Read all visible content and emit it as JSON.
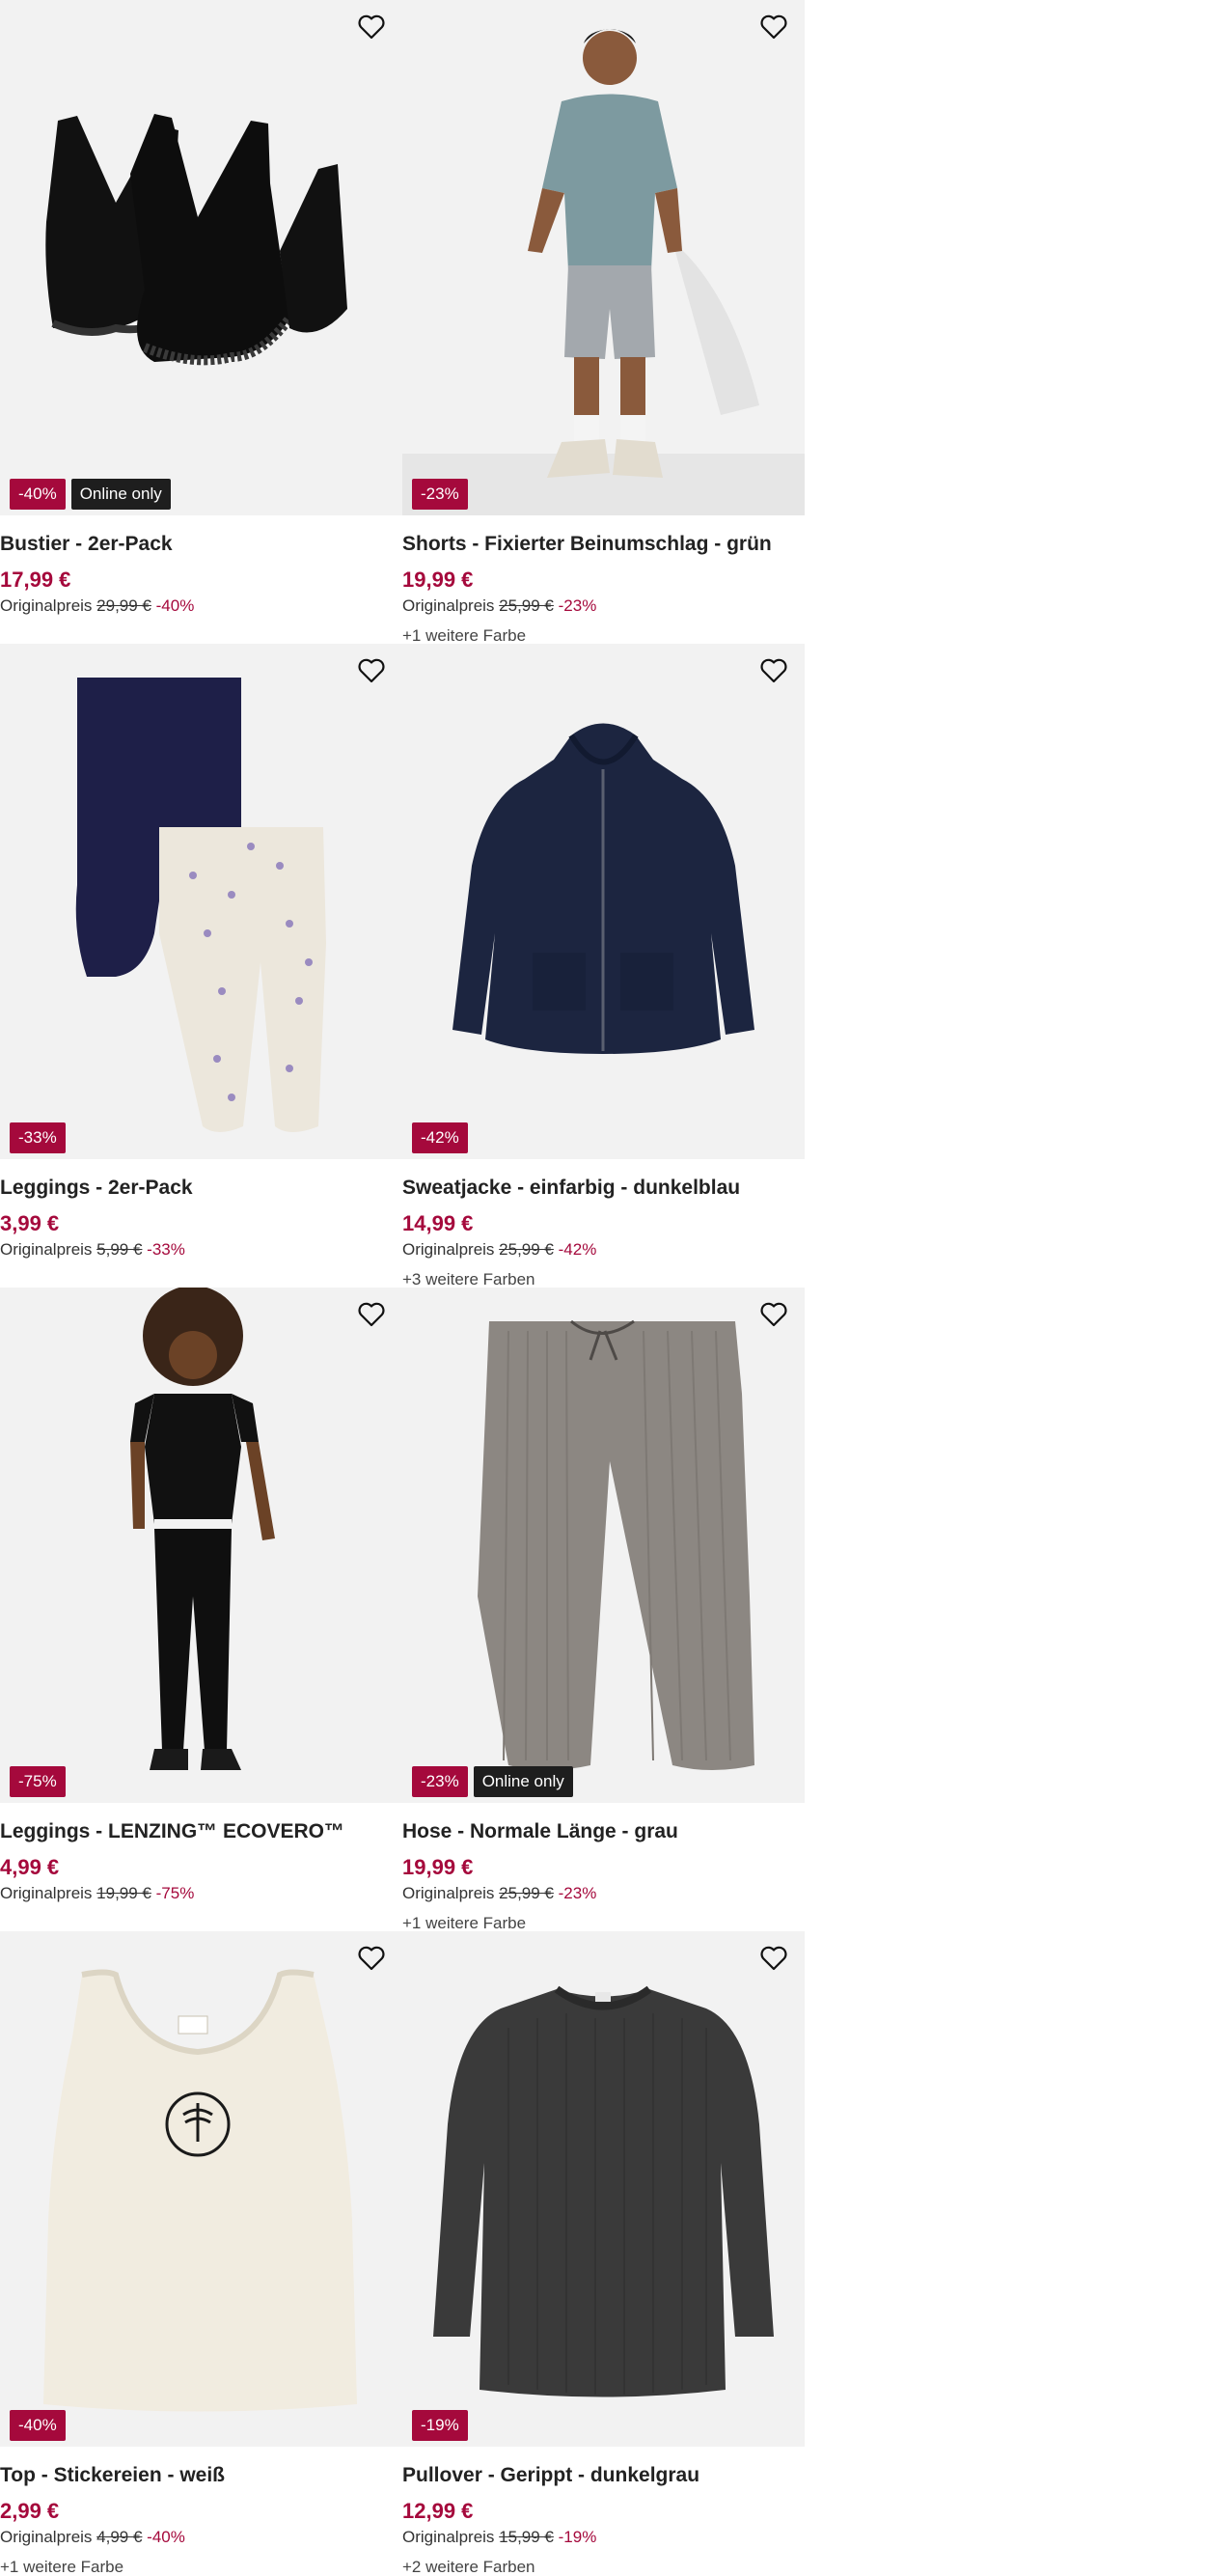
{
  "products": [
    {
      "title": "Bustier - 2er-Pack",
      "price": "17,99 €",
      "orig_label": "Originalpreis",
      "orig_price": "29,99 €",
      "discount": "-40%",
      "badge": "-40%",
      "online": "Online only",
      "more": ""
    },
    {
      "title": "Shorts - Fixierter Beinumschlag - grün",
      "price": "19,99 €",
      "orig_label": "Originalpreis",
      "orig_price": "25,99 €",
      "discount": "-23%",
      "badge": "-23%",
      "online": "",
      "more": "+1 weitere Farbe"
    },
    {
      "title": "Leggings - 2er-Pack",
      "price": "3,99 €",
      "orig_label": "Originalpreis",
      "orig_price": "5,99 €",
      "discount": "-33%",
      "badge": "-33%",
      "online": "",
      "more": ""
    },
    {
      "title": "Sweatjacke - einfarbig - dunkelblau",
      "price": "14,99 €",
      "orig_label": "Originalpreis",
      "orig_price": "25,99 €",
      "discount": "-42%",
      "badge": "-42%",
      "online": "",
      "more": "+3 weitere Farben"
    },
    {
      "title": "Leggings - LENZING™ ECOVERO™",
      "price": "4,99 €",
      "orig_label": "Originalpreis",
      "orig_price": "19,99 €",
      "discount": "-75%",
      "badge": "-75%",
      "online": "",
      "more": ""
    },
    {
      "title": "Hose - Normale Länge - grau",
      "price": "19,99 €",
      "orig_label": "Originalpreis",
      "orig_price": "25,99 €",
      "discount": "-23%",
      "badge": "-23%",
      "online": "Online only",
      "more": "+1 weitere Farbe"
    },
    {
      "title": "Top - Stickereien - weiß",
      "price": "2,99 €",
      "orig_label": "Originalpreis",
      "orig_price": "4,99 €",
      "discount": "-40%",
      "badge": "-40%",
      "online": "",
      "more": "+1 weitere Farbe"
    },
    {
      "title": "Pullover - Gerippt - dunkelgrau",
      "price": "12,99 €",
      "orig_label": "Originalpreis",
      "orig_price": "15,99 €",
      "discount": "-19%",
      "badge": "-19%",
      "online": "",
      "more": "+2 weitere Farben"
    }
  ],
  "colors": {
    "accent": "#a5093c",
    "badge_dark": "#1e1e1e",
    "image_bg": "#f2f2f2"
  },
  "icons": {
    "wishlist": "heart-outline-icon"
  }
}
